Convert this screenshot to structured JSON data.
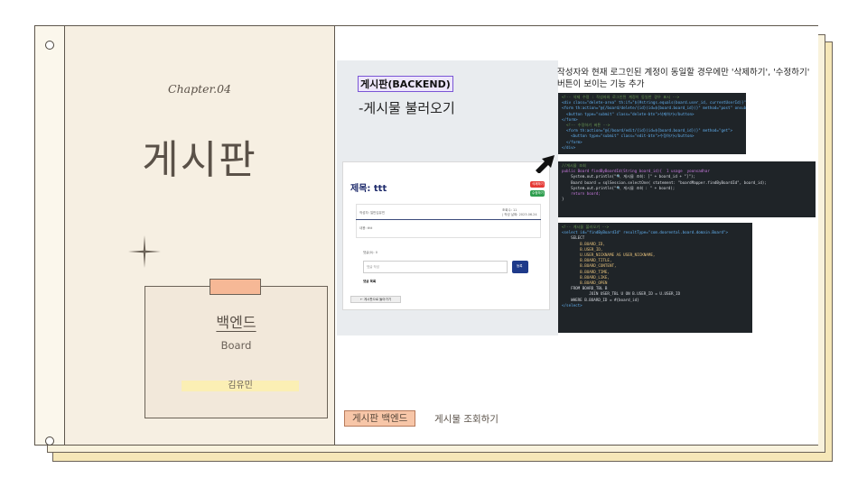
{
  "left": {
    "chapter": "Chapter.04",
    "title": "게시판",
    "card": {
      "title": "백엔드",
      "subtitle": "Board",
      "author": "김유민"
    }
  },
  "right": {
    "section_title": "게시판(BACKEND)",
    "section_subtitle": "-게시물 불러오기",
    "description": "작성자와 현재 로그인된 계정이 동일할 경우에만 '삭제하기', '수정하기' 버튼이 보이는 기능 추가",
    "mock": {
      "title": "제목: ttt",
      "writer": "작성자: 일반김유민",
      "meta_views": "조회수: 11",
      "meta_date": "| 작성 날짜: 2023.06.24",
      "content": "내용: tttt",
      "comment_count": "댓글(0): 0",
      "comment_placeholder": "댓글 작성",
      "submit_label": "등록",
      "comment_list": "댓글 목록",
      "back_label": "← 게시판으로 돌아가기",
      "delete_label": "삭제하기",
      "edit_label": "수정하기",
      "colors": {
        "delete": "#e53935",
        "edit": "#2e9e4e",
        "submit": "#1e3a8a"
      }
    },
    "code1": [
      "<!-- 삭제 수정 : 작성자와 로그인된 계정이 동일한 경우 표시 -->",
      "<div class=\"delete-area\" th:if=\"${#strings.equals(board.user_id, currentUserId)}\">",
      "<form th:action=\"@{/board/delete/{id}(id=${board.board_id})}\" method=\"post\" onsubmit=",
      "  <button type=\"submit\" class=\"delete-btn\">삭제하기</button>",
      "</form>",
      "  <!-- 수정하기 버튼 -->",
      "  <form th:action=\"@{/board/edit/{id}(id=${board.board_id})}\" method=\"get\">",
      "    <button type=\"submit\" class=\"edit-btn\">수정하기</button>",
      "  </form>",
      "</div>"
    ],
    "code2": [
      "//게시물 조회",
      "public Board findByBoardId(String board_id){  1 usage  yoonsadhar",
      "    System.out.println(\"🔍 게시물 조회: [\" + board_id + \"]\");",
      "    Board board = sqlSession.selectOne( statement: \"boardMapper.findByBoardId\", board_id);",
      "    System.out.println(\"🔍 게시물 조회 : \" + board);",
      "    return board;",
      "}"
    ],
    "code3": [
      "<!-- 게시물 불러오기 -->",
      "<select id=\"findByBoardId\" resultType=\"com.doorental.board.domain.Board\">",
      "    SELECT",
      "        B.BOARD_ID,",
      "        B.USER_ID,",
      "        U.USER_NICKNAME AS USER_NICKNAME,",
      "        B.BOARD_TITLE,",
      "        B.BOARD_CONTENT,",
      "        B.BOARD_TIME,",
      "        B.BOARD_LIKE,",
      "        B.BOARD_OPEN",
      "    FROM BOARD_TBL B",
      "            JOIN USER_TBL U ON B.USER_ID = U.USER_ID",
      "    WHERE B.BOARD_ID = #{board_id}",
      "</select>"
    ],
    "footer": {
      "tag": "게시판 백엔드",
      "text": "게시물 조회하기"
    }
  }
}
